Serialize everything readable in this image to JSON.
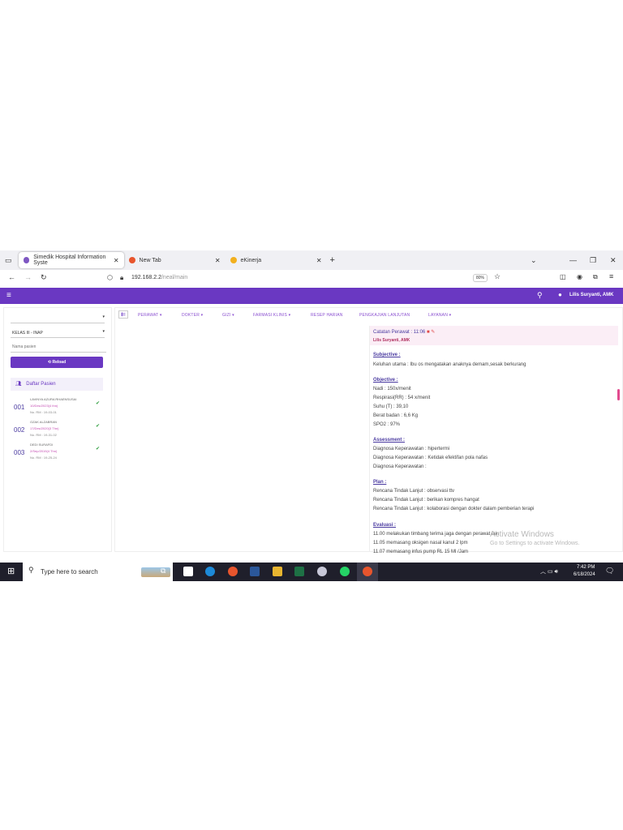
{
  "tabs": [
    {
      "title": "Simedik Hospital Information Syste",
      "active": true
    },
    {
      "title": "New Tab",
      "active": false
    },
    {
      "title": "eKinerja",
      "active": false
    }
  ],
  "url": {
    "host": "192.168.2.2",
    "path": "/neal/main",
    "zoom": "80%"
  },
  "header": {
    "user": "Lilis Suryanti, AMK"
  },
  "sidebar": {
    "select1": "",
    "kelas": "KELAS III - INAP",
    "search_placeholder": "Nama pasien",
    "reload": "Reload",
    "list_title": "Daftar Pasien",
    "patients": [
      {
        "num": "001",
        "name": "LAVINYA AZURA RHAENSUSAI",
        "date": "10/Des/2023(4 thn)",
        "rm": "No. RM : 19-03-01"
      },
      {
        "num": "002",
        "name": "OZAK ALZABRAN",
        "date": "17/Des/2020(3 Thn)",
        "rm": "No. RM : 19-31-02"
      },
      {
        "num": "003",
        "name": "DEDI SURAFDI",
        "date": "2/Sep/2019(4 Thn)",
        "rm": "No. RM : 19-25-24"
      }
    ]
  },
  "menus": [
    "PERAWAT",
    "DOKTER",
    "GIZI",
    "FARMASI KLINIS",
    "RESEP HARIAN",
    "PENGKAJIAN LANJUTAN",
    "LAYANAN"
  ],
  "note": {
    "title": "Catatan Perawat : 11:06",
    "author": "Lilis Suryanti, AMK",
    "subjective_h": "Subjective :",
    "subjective": "Keluhan utama : Ibu os mengatakan anaknya demam,sesak berkurang",
    "objective_h": "Objective :",
    "objective": [
      "Nadi : 150x/menit",
      "Respirasi(RR) : 54 x/menit",
      "Suhu (T) : 39,10",
      "Berat badan : 6,6 Kg",
      "SPO2 : 97%"
    ],
    "assessment_h": "Assessment :",
    "assessment": [
      "Diagnosa Keperawatan : hipertermi",
      "Diagnosa Keperawatan : Ketidak efektifan pola nafas",
      "Diagnosa Keperawatan :"
    ],
    "plan_h": "Plan :",
    "plan": [
      "Rencana Tindak Lanjut : observasi ttv",
      "Rencana Tindak Lanjut : berikan kompres hangat",
      "Rencana Tindak Lanjut : kolaborasi dengan dokter dalam pemberian terapi"
    ],
    "evaluasi_h": "Evaluasi :",
    "evaluasi": [
      "11.00 melakukan timbang terima jaga dengan perawat lain",
      "11.05 memasang oksigen nasal kanul 2 lpm",
      "11.07 memasang infus pump RL 15 Ml /Jam"
    ]
  },
  "watermark": {
    "title": "Activate Windows",
    "sub": "Go to Settings to activate Windows."
  },
  "taskbar": {
    "search": "Type here to search",
    "time": "7:42 PM",
    "date": "6/18/2024"
  }
}
